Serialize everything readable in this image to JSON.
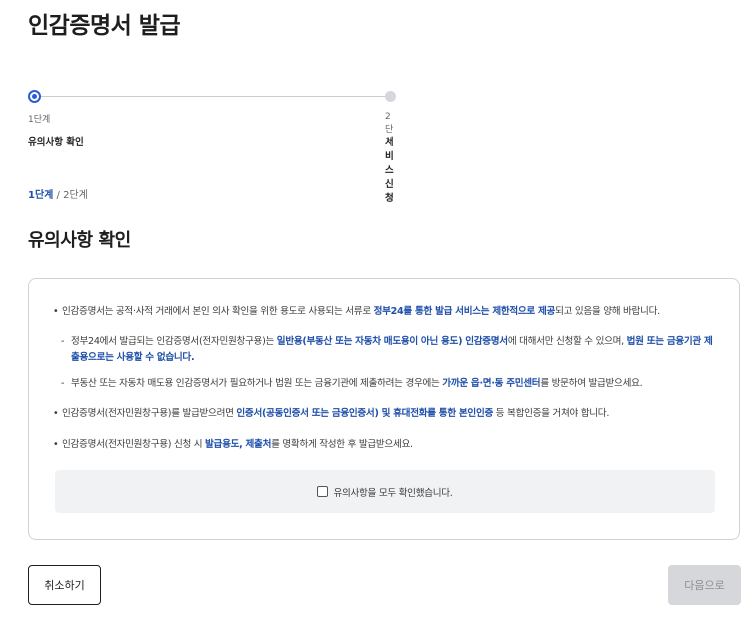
{
  "page": {
    "title": "인감증명서 발급",
    "section_title": "유의사항 확인"
  },
  "stepper": {
    "steps": [
      {
        "num": "1단계",
        "label": "유의사항 확인",
        "active": true
      },
      {
        "num": "2단계",
        "label": "서비스 신청",
        "active": false
      }
    ],
    "crumb_current": "1단계",
    "crumb_sep": " / ",
    "crumb_total": "2단계"
  },
  "notice": {
    "item1": {
      "a": "인감증명서는 공적·사적 거래에서 본인 의사 확인을 위한 용도로 사용되는 서류로 ",
      "b": "정부24를 통한 발급 서비스는 제한적으로 제공",
      "c": "되고 있음을 양해 바랍니다."
    },
    "sub1": {
      "a": "정부24에서 발급되는 인감증명서(전자민원창구용)는 ",
      "b": "일반용(부동산 또는 자동차 매도용이 아닌 용도) 인감증명서",
      "c": "에 대해서만 신청할 수 있으며, ",
      "d": "법원 또는 금융기관 제출용으로는 사용할 수 없습니다."
    },
    "sub2": {
      "a": "부동산 또는 자동차 매도용 인감증명서가 필요하거나 법원 또는 금융기관에 제출하려는 경우에는 ",
      "b": "가까운 읍·면·동 주민센터",
      "c": "를 방문하여 발급받으세요."
    },
    "item2": {
      "a": "인감증명서(전자민원창구용)를 발급받으려면 ",
      "b": "인증서(공동인증서 또는 금융인증서) 및 휴대전화를 통한 본인인증",
      "c": " 등 복합인증을 거쳐야 합니다."
    },
    "item3": {
      "a": "인감증명서(전자민원창구용) 신청 시 ",
      "b": "발급용도, 제출처",
      "c": "를 명확하게 작성한 후 발급받으세요."
    },
    "confirm_label": "유의사항을 모두 확인했습니다.",
    "confirm_checked": false
  },
  "buttons": {
    "cancel": "취소하기",
    "next": "다음으로"
  },
  "colors": {
    "accent": "#2a5cd6",
    "highlight_text": "#1f4fa8",
    "disabled_bg": "#d5d7da"
  }
}
